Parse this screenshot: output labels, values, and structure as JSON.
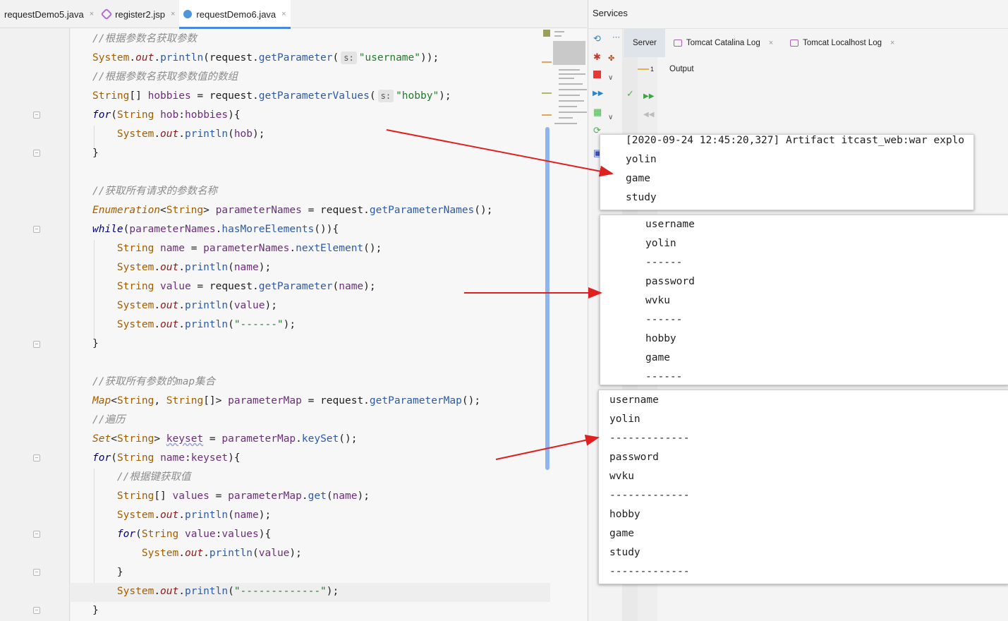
{
  "editor": {
    "tabs": [
      {
        "label": "requestDemo5.java",
        "active": false
      },
      {
        "label": "register2.jsp",
        "active": false
      },
      {
        "label": "requestDemo6.java",
        "active": true
      }
    ],
    "close_glyph": "×"
  },
  "code": {
    "c1": "//根据参数名获取参数",
    "c2": "//根据参数名获取参数值的数组",
    "c3": "//获取所有请求的参数名称",
    "c4a": "//获取所有参数的",
    "c4b": "map",
    "c4c": "集合",
    "c5": "//遍历",
    "c6": "//根据键获取值",
    "hint_s": "s:",
    "str_username": "\"username\"",
    "str_hobby": "\"hobby\"",
    "str_dash6": "\"------\"",
    "str_dash13": "\"-------------\""
  },
  "services": {
    "title": "Services",
    "tabs": {
      "server": "Server",
      "catalina": "Tomcat Catalina Log",
      "localhost": "Tomcat Localhost Log"
    },
    "output_label": "Output",
    "output_num": "1"
  },
  "console": {
    "panel1": [
      "[2020-09-24 12:45:20,327] Artifact itcast_web:war explo",
      "yolin",
      "game",
      "study"
    ],
    "panel2": [
      "username",
      "yolin",
      "------",
      "password",
      "wvku",
      "------",
      "hobby",
      "game",
      "------"
    ],
    "panel3": [
      "username",
      "yolin",
      "-------------",
      "password",
      "wvku",
      "-------------",
      "hobby",
      "game",
      "study",
      "-------------"
    ]
  },
  "colors": {
    "accent_tab": "#4a88e0",
    "arrow": "#e02020",
    "scrollbar": "#8fb4ee"
  }
}
